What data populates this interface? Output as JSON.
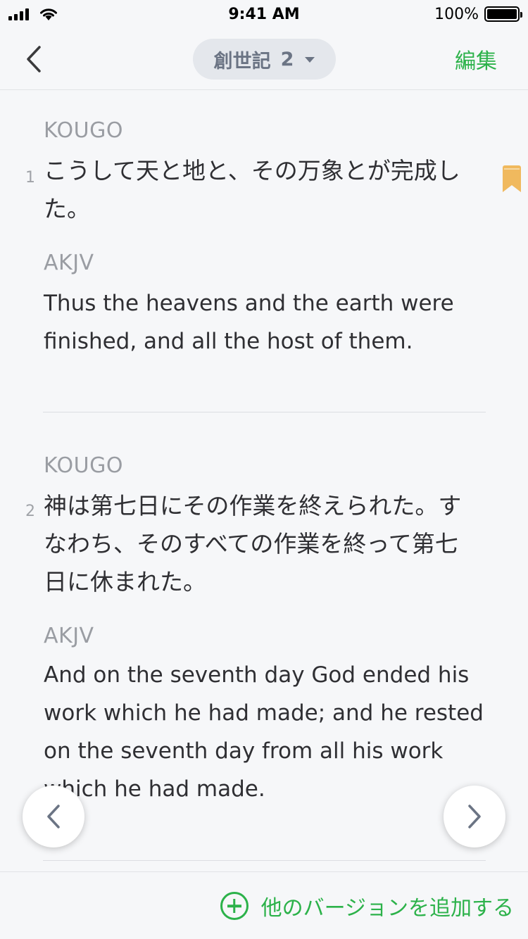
{
  "status_bar": {
    "time": "9:41 AM",
    "battery_text": "100%",
    "battery_level": 1.0
  },
  "nav": {
    "book_title": "創世記",
    "chapter": "2",
    "edit_label": "編集",
    "back_icon": "chevron-left-icon",
    "dropdown_icon": "caret-down-icon"
  },
  "verses": [
    {
      "number": "1",
      "bookmarked": true,
      "translations": [
        {
          "version": "KOUGO",
          "text": "こうして天と地と、その万象とが完成した。"
        },
        {
          "version": "AKJV",
          "text": "Thus the heavens and the earth were finished, and all the host of them."
        }
      ]
    },
    {
      "number": "2",
      "bookmarked": false,
      "translations": [
        {
          "version": "KOUGO",
          "text": "神は第七日にその作業を終えられた。すなわち、そのすべての作業を終って第七日に休まれた。"
        },
        {
          "version": "AKJV",
          "text": "And on the seventh day God ended his work which he had made; and he rested on the seventh day from all his work which he had made."
        }
      ]
    }
  ],
  "bottom": {
    "add_version_label": "他のバージョンを追加する",
    "add_icon": "plus-circle-icon"
  },
  "floating_nav": {
    "prev_icon": "chevron-left-icon",
    "next_icon": "chevron-right-icon"
  },
  "colors": {
    "accent": "#2cb24a",
    "bookmark": "#f0b95e",
    "background": "#f6f7f9",
    "selector_bg": "#e4e7ec"
  }
}
